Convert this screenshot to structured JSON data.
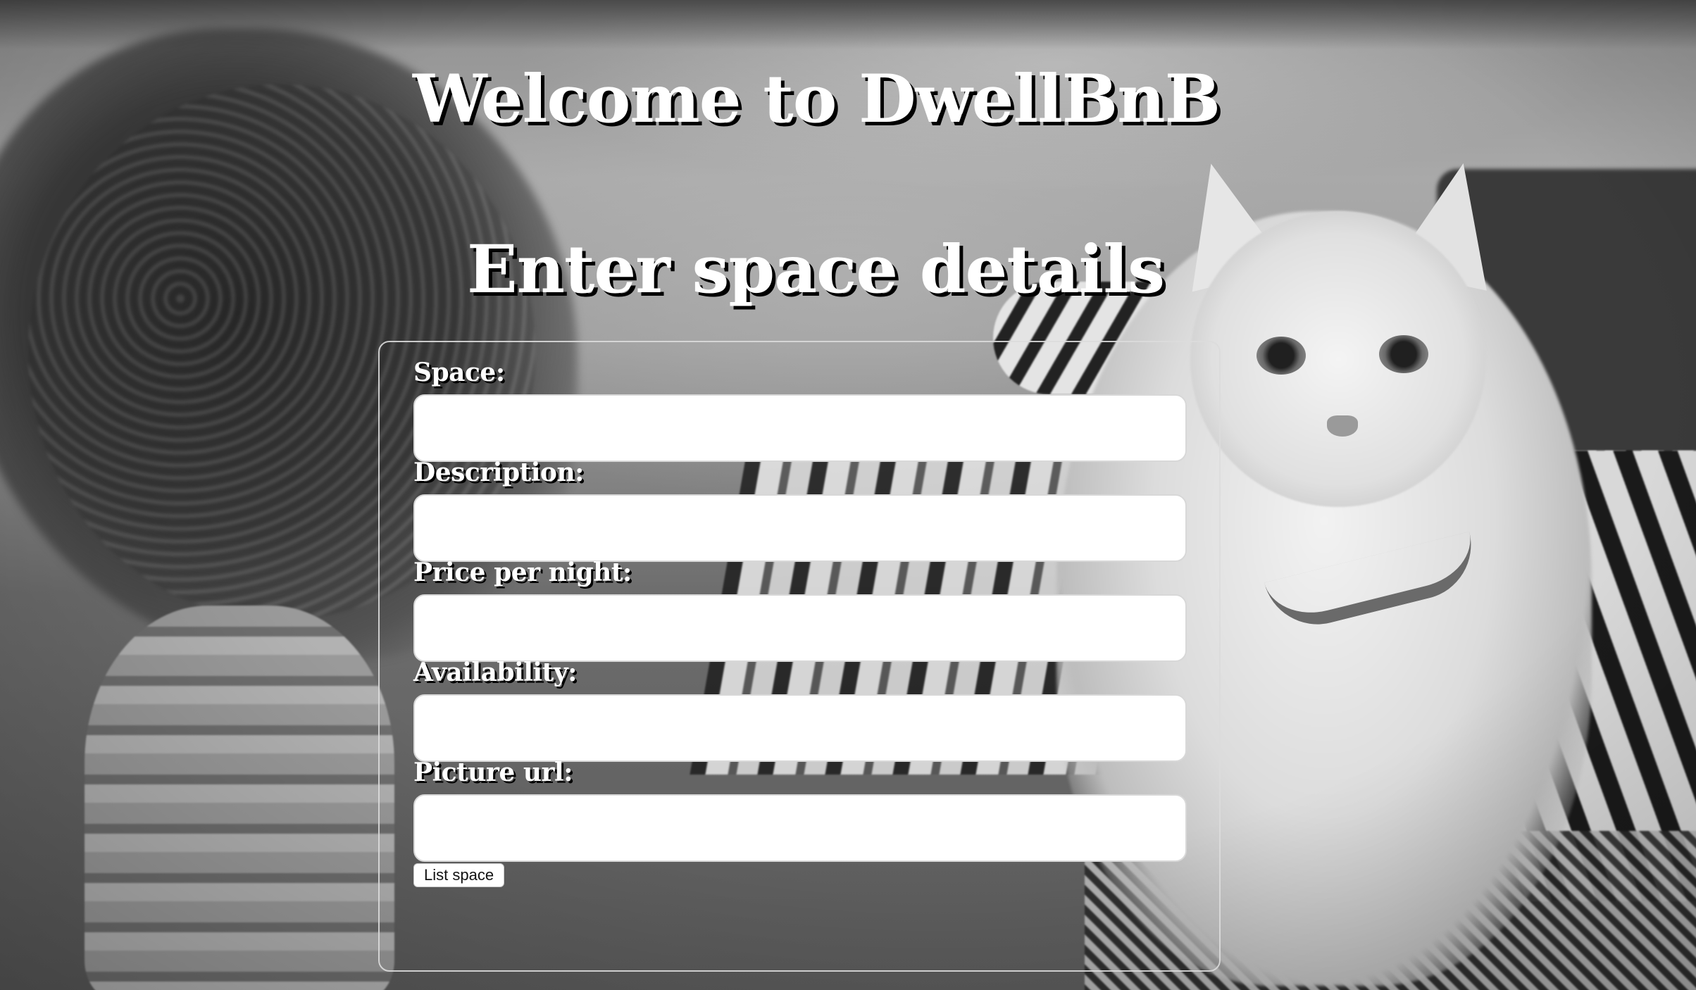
{
  "page": {
    "heading": "Welcome to DwellBnB",
    "subheading": "Enter space details"
  },
  "form": {
    "fields": [
      {
        "label": "Space:",
        "value": "",
        "placeholder": ""
      },
      {
        "label": "Description:",
        "value": "",
        "placeholder": ""
      },
      {
        "label": "Price per night:",
        "value": "",
        "placeholder": ""
      },
      {
        "label": "Availability:",
        "value": "",
        "placeholder": ""
      },
      {
        "label": "Picture url:",
        "value": "",
        "placeholder": ""
      }
    ],
    "submit_label": "List space"
  },
  "background": {
    "description_type": "grayscale photo",
    "tone": "#7c7c7c"
  }
}
